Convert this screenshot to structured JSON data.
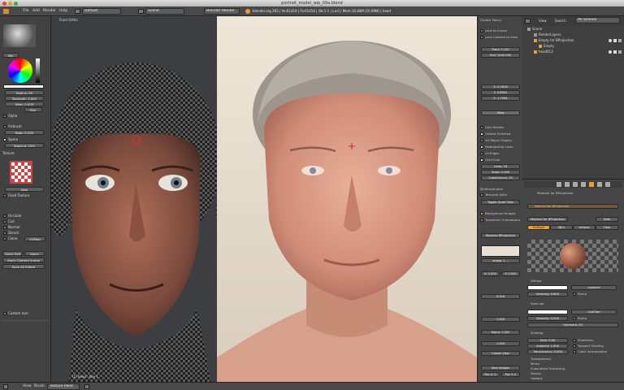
{
  "window": {
    "title": "portrait_model_wip_09a.blend"
  },
  "info_header": {
    "menus": [
      "File",
      "Add",
      "Render",
      "Help"
    ],
    "layout": "Default",
    "scene": "Scene",
    "engine": "Blender Render",
    "stats": "blender.org 263 | Ve:61419 | Fa:61414 | Ob:1-1 | La:0 | Mem:16.84M (10.99M) | head"
  },
  "left_toolbar": {
    "color_mode": "Mix",
    "radius": "Radius: 35",
    "strength": "Strength: 1.000",
    "jitter": "Jitter: 0.000",
    "blur": "Blur",
    "alpha_label": "Alpha",
    "airbrush_label": "Airbrush",
    "rate": "Rate: 0.100",
    "space_label": "Space",
    "spacing": "Spacing: 10%",
    "texture_label": "Texture",
    "new_button": "New",
    "fixed_texture": "Fixed Texture",
    "options": [
      "Occlude",
      "Cull",
      "Normal",
      "Stencil",
      "Clone"
    ],
    "layer_value": "UVMap",
    "quick_edit": "Quick Edit",
    "apply": "Apply",
    "apply_camera": "Apply Camera Image",
    "save_all": "Save All Edited",
    "custom_icon": "Custom Icon"
  },
  "viewport": {
    "label_left": "Front Ortho",
    "label_bottom": "(1) head : Key 1"
  },
  "n_panel": {
    "header": "Grease Pencil",
    "lock_cursor": "Lock to Cursor",
    "lock_camera": "Lock Camera to View",
    "clip_start": "Start: 0.100",
    "clip_end": "End: 1000.000",
    "loc": [
      "X: 0.2616",
      "Y: 0.6801",
      "Z: 1.7434"
    ],
    "view_label": "View",
    "display_options": [
      "Only Render",
      "Outline Selected",
      "All Object Origins",
      "Relationship Lines",
      "All Edges"
    ],
    "grid_floor": "Grid Floor",
    "lines": "Lines: 16",
    "scale": "Scale: 1.000",
    "subdivisions": "Subdivisions: 10",
    "multires": "Multiresolution",
    "textured_solid": "Textured Solid",
    "toggle_quad": "Toggle Quad View",
    "bg_images": "Background Images",
    "transform_orientations": "Transform Orientations",
    "remove_bg": "Remove BProjection",
    "image_from": "Image: 1 ...",
    "size_fields": [
      "X: 0.000",
      "Y: 0.000"
    ],
    "rotation": "0.000",
    "opacity": "1.000",
    "alpha": "Alpha: 1.000",
    "scale2": "1.000",
    "create_view": "Create View",
    "new_images": "New Images",
    "pos_fields": [
      "Pos X: 0",
      "Pos Y: 0"
    ]
  },
  "outliner": {
    "view_label": "View",
    "search_label": "Search",
    "filter": "All Scenes",
    "items": [
      "Scene",
      "RenderLayers",
      "Empty for BProjection",
      "Empty",
      "head013"
    ]
  },
  "properties": {
    "material_name": "Material for BProjection",
    "slot_name": "Material for BProjection",
    "data_label": "Data",
    "tabs": [
      "Surface",
      "Wire",
      "Volume",
      "Halo"
    ],
    "diffuse_label": "Diffuse",
    "lambert": "Lambert",
    "intensity": "Intensity: 0.800",
    "ramp": "Ramp",
    "specular_label": "Specular",
    "cooktorr": "CookTorr",
    "spec_intensity": "Intensity: 0.500",
    "hardness": "Hardness: 50",
    "shading_label": "Shading",
    "emit": "Emit: 0.00",
    "ambient": "Ambient: 1.000",
    "translucency": "Translucency: 0.000",
    "shadeless": "Shadeless",
    "tangent": "Tangent Shading",
    "cubic": "Cubic Interpolation",
    "sections": [
      "Transparency",
      "Mirror",
      "Subsurface Scattering",
      "Strand",
      "Options",
      "Shadow"
    ]
  },
  "bottom_bar": {
    "view": "View",
    "brush": "Brush",
    "mode": "Texture Paint"
  },
  "colors": {
    "accent": "#e8a030",
    "panel_bg": "#454545",
    "field_bg": "#5c5c5c",
    "viewport_bg": "#3c3e42"
  }
}
